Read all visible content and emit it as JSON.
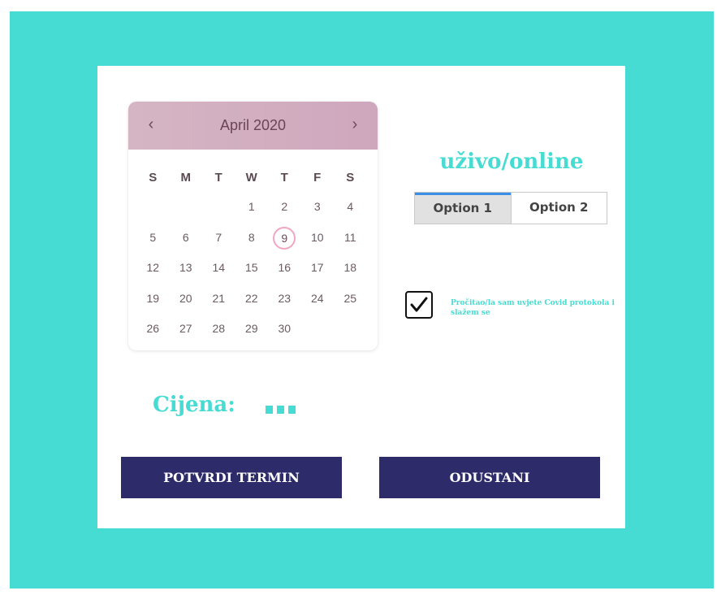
{
  "calendar": {
    "month_label": "April 2020",
    "prev_icon": "‹",
    "next_icon": "›",
    "weekdays": [
      "S",
      "M",
      "T",
      "W",
      "T",
      "F",
      "S"
    ],
    "leading_blanks": 3,
    "days": [
      "1",
      "2",
      "3",
      "4",
      "5",
      "6",
      "7",
      "8",
      "9",
      "10",
      "11",
      "12",
      "13",
      "14",
      "15",
      "16",
      "17",
      "18",
      "19",
      "20",
      "21",
      "22",
      "23",
      "24",
      "25",
      "26",
      "27",
      "28",
      "29",
      "30"
    ],
    "selected_day": "9",
    "selected_color": "#f2a6c2",
    "header_color": "#d0aabf"
  },
  "mode": {
    "title": "uživo/online",
    "options": [
      "Option 1",
      "Option 2"
    ],
    "active_option": "Option 1"
  },
  "consent": {
    "checked": true,
    "text": "Pročitao/la sam uvjete Covid protokola i slažem se"
  },
  "price": {
    "label": "Cijena:"
  },
  "buttons": {
    "confirm_label": "POTVRDI TERMIN",
    "cancel_label": "ODUSTANI"
  },
  "colors": {
    "accent": "#46dcd3",
    "button_bg": "#2e2b6b",
    "tab_active_border": "#3b8de6"
  }
}
